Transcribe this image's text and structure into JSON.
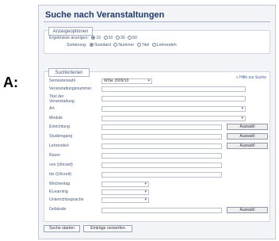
{
  "outer_label": "A:",
  "page_title": "Suche nach Veranstaltungen",
  "display_options": {
    "legend": "Anzeigeoptionen",
    "results_label": "Ergebnisse anzeigen:",
    "results_options": [
      "10",
      "20",
      "30",
      "60"
    ],
    "results_selected": "10",
    "sort_label": "Sortierung:",
    "sort_options": [
      "Standard",
      "Nummer",
      "Titel",
      "Lehrendeh"
    ],
    "sort_selected": "Standard"
  },
  "criteria": {
    "legend": "Suchkriterien",
    "help_link": "» Hilfe zur Suche",
    "semester_label": "Semesterwahl",
    "semester_value": "WiSe 2009/10",
    "fields": [
      {
        "label": "Veranstaltungsnummer"
      },
      {
        "label": "Titel der Veranstaltung"
      },
      {
        "label": "Art"
      },
      {
        "label": "Module"
      },
      {
        "label": "Einrichtung"
      },
      {
        "label": "Studiengang"
      },
      {
        "label": "Lehrende/r"
      },
      {
        "label": "Raum"
      },
      {
        "label": "von (Uhrzeit)"
      },
      {
        "label": "bis (Uhrzeit)"
      },
      {
        "label": "Wochentag"
      },
      {
        "label": "ELearning"
      },
      {
        "label": "Unterrichtssprache"
      },
      {
        "label": "Gebäude"
      }
    ],
    "select_button_label": "Auswahl"
  },
  "footer": {
    "start_label": "Suche starten",
    "reset_label": "Einträge verwerfen"
  }
}
